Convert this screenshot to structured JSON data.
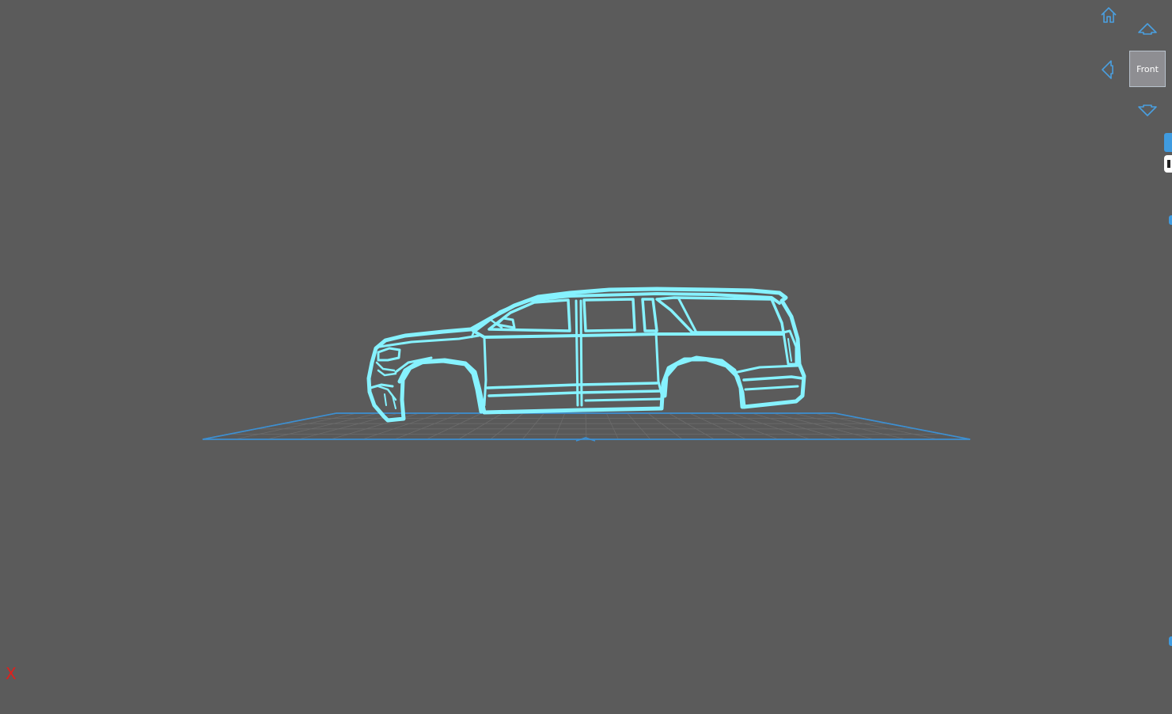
{
  "viewcube": {
    "face_label": "Front",
    "icons": {
      "home": "home-icon",
      "up": "arrow-up-icon",
      "left": "arrow-left-icon",
      "down": "arrow-down-icon"
    },
    "icon_color": "#4a9fe0"
  },
  "axis": {
    "x_label": "X",
    "x_color": "#e0201c"
  },
  "scene": {
    "background": "#5b5b5b",
    "model_color": "#86f2ff",
    "grid_color": "#3d8fd1"
  }
}
